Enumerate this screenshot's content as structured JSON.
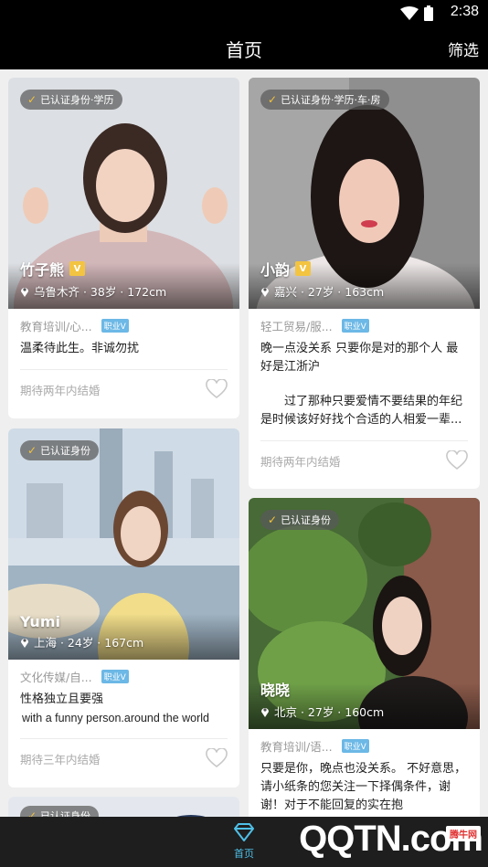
{
  "status": {
    "time": "2:38"
  },
  "appbar": {
    "title": "首页",
    "filter_label": "筛选"
  },
  "cards": [
    {
      "verify": "已认证身份·学历",
      "name": "竹子熊",
      "vip": "V",
      "meta": "乌鲁木齐 · 38岁 · 172cm",
      "job": "教育培训/心...",
      "jobtag": "职业V",
      "bio": "温柔待此生。非诚勿扰",
      "hope": "期待两年内结婚"
    },
    {
      "verify": "已认证身份·学历·车·房",
      "name": "小韵",
      "vip": "V",
      "meta": "嘉兴 · 27岁 · 163cm",
      "job": "轻工贸易/服...",
      "jobtag": "职业V",
      "bio": "晚一点没关系 只要你是对的那个人 最好是江浙沪",
      "bio2": "过了那种只要爱情不要结果的年纪 是时候该好好找个合适的人相爱一辈...",
      "hope": "期待两年内结婚"
    },
    {
      "verify": "已认证身份",
      "name": "Yumi",
      "meta": "上海 · 24岁 · 167cm",
      "job": "文化传媒/自...",
      "jobtag": "职业V",
      "bio": "性格独立且要强",
      "bio_en": "with a funny person.around the world",
      "hope": "期待三年内结婚"
    },
    {
      "verify": "已认证身份",
      "name": "晓晓",
      "meta": "北京 · 27岁 · 160cm",
      "job": "教育培训/语...",
      "jobtag": "职业V",
      "bio": "只要是你，晚点也没关系。 不好意思，请小纸条的您关注一下择偶条件，谢谢！对于不能回复的实在抱"
    },
    {
      "verify": "已认证身份"
    }
  ],
  "tabbar": {
    "home_label": "首页"
  },
  "watermark": {
    "text": "QQTN.com",
    "badge": "腾牛网"
  },
  "colors": {
    "accent": "#4fc0e8",
    "vip": "#f3c441",
    "bar": "#000000"
  }
}
